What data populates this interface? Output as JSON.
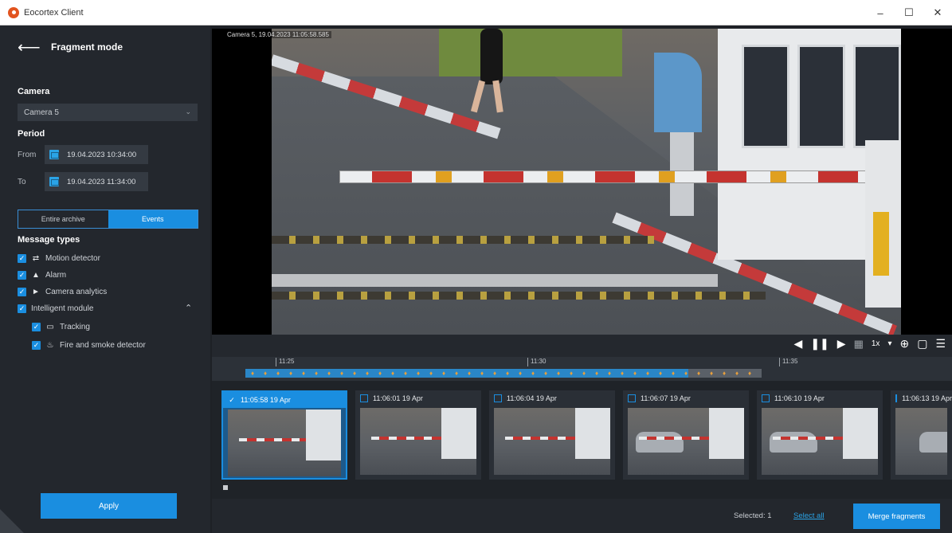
{
  "window": {
    "title": "Eocortex Client",
    "minimize": "–",
    "maximize": "☐",
    "close": "✕"
  },
  "sidebar": {
    "title": "Fragment mode",
    "camera_label": "Camera",
    "camera_value": "Camera 5",
    "period_label": "Period",
    "from_label": "From",
    "from_value": "19.04.2023   10:34:00",
    "to_label": "To",
    "to_value": "19.04.2023   11:34:00",
    "segment": {
      "archive": "Entire archive",
      "events": "Events",
      "active": "events"
    },
    "message_types_label": "Message types",
    "message_types": [
      {
        "label": "Motion detector",
        "checked": true,
        "icon": "motion-icon"
      },
      {
        "label": "Alarm",
        "checked": true,
        "icon": "alarm-icon"
      },
      {
        "label": "Camera analytics",
        "checked": true,
        "icon": "camera-analytics-icon"
      },
      {
        "label": "Intelligent module",
        "checked": true,
        "icon": ""
      },
      {
        "label": "Tracking",
        "checked": true,
        "icon": "tracking-icon"
      },
      {
        "label": "Fire and smoke detector",
        "checked": true,
        "icon": "fire-icon"
      }
    ],
    "apply_label": "Apply"
  },
  "video": {
    "timestamp": "Camera 5, 19.04.2023 11:05:58.585",
    "speed": "1x"
  },
  "timeline": {
    "ticks": [
      "11:25",
      "11:30",
      "11:35"
    ]
  },
  "fragments": [
    {
      "time": "11:05:58 19 Apr",
      "selected": true
    },
    {
      "time": "11:06:01 19 Apr",
      "selected": false
    },
    {
      "time": "11:06:04 19 Apr",
      "selected": false
    },
    {
      "time": "11:06:07 19 Apr",
      "selected": false
    },
    {
      "time": "11:06:10 19 Apr",
      "selected": false
    },
    {
      "time": "11:06:13 19 Apr",
      "selected": false
    }
  ],
  "bottom": {
    "selected_text": "Selected: 1",
    "select_all": "Select all",
    "merge_label": "Merge fragments"
  },
  "colors": {
    "accent": "#1a8ee0",
    "panel": "#23272d",
    "background": "#1e2126"
  }
}
